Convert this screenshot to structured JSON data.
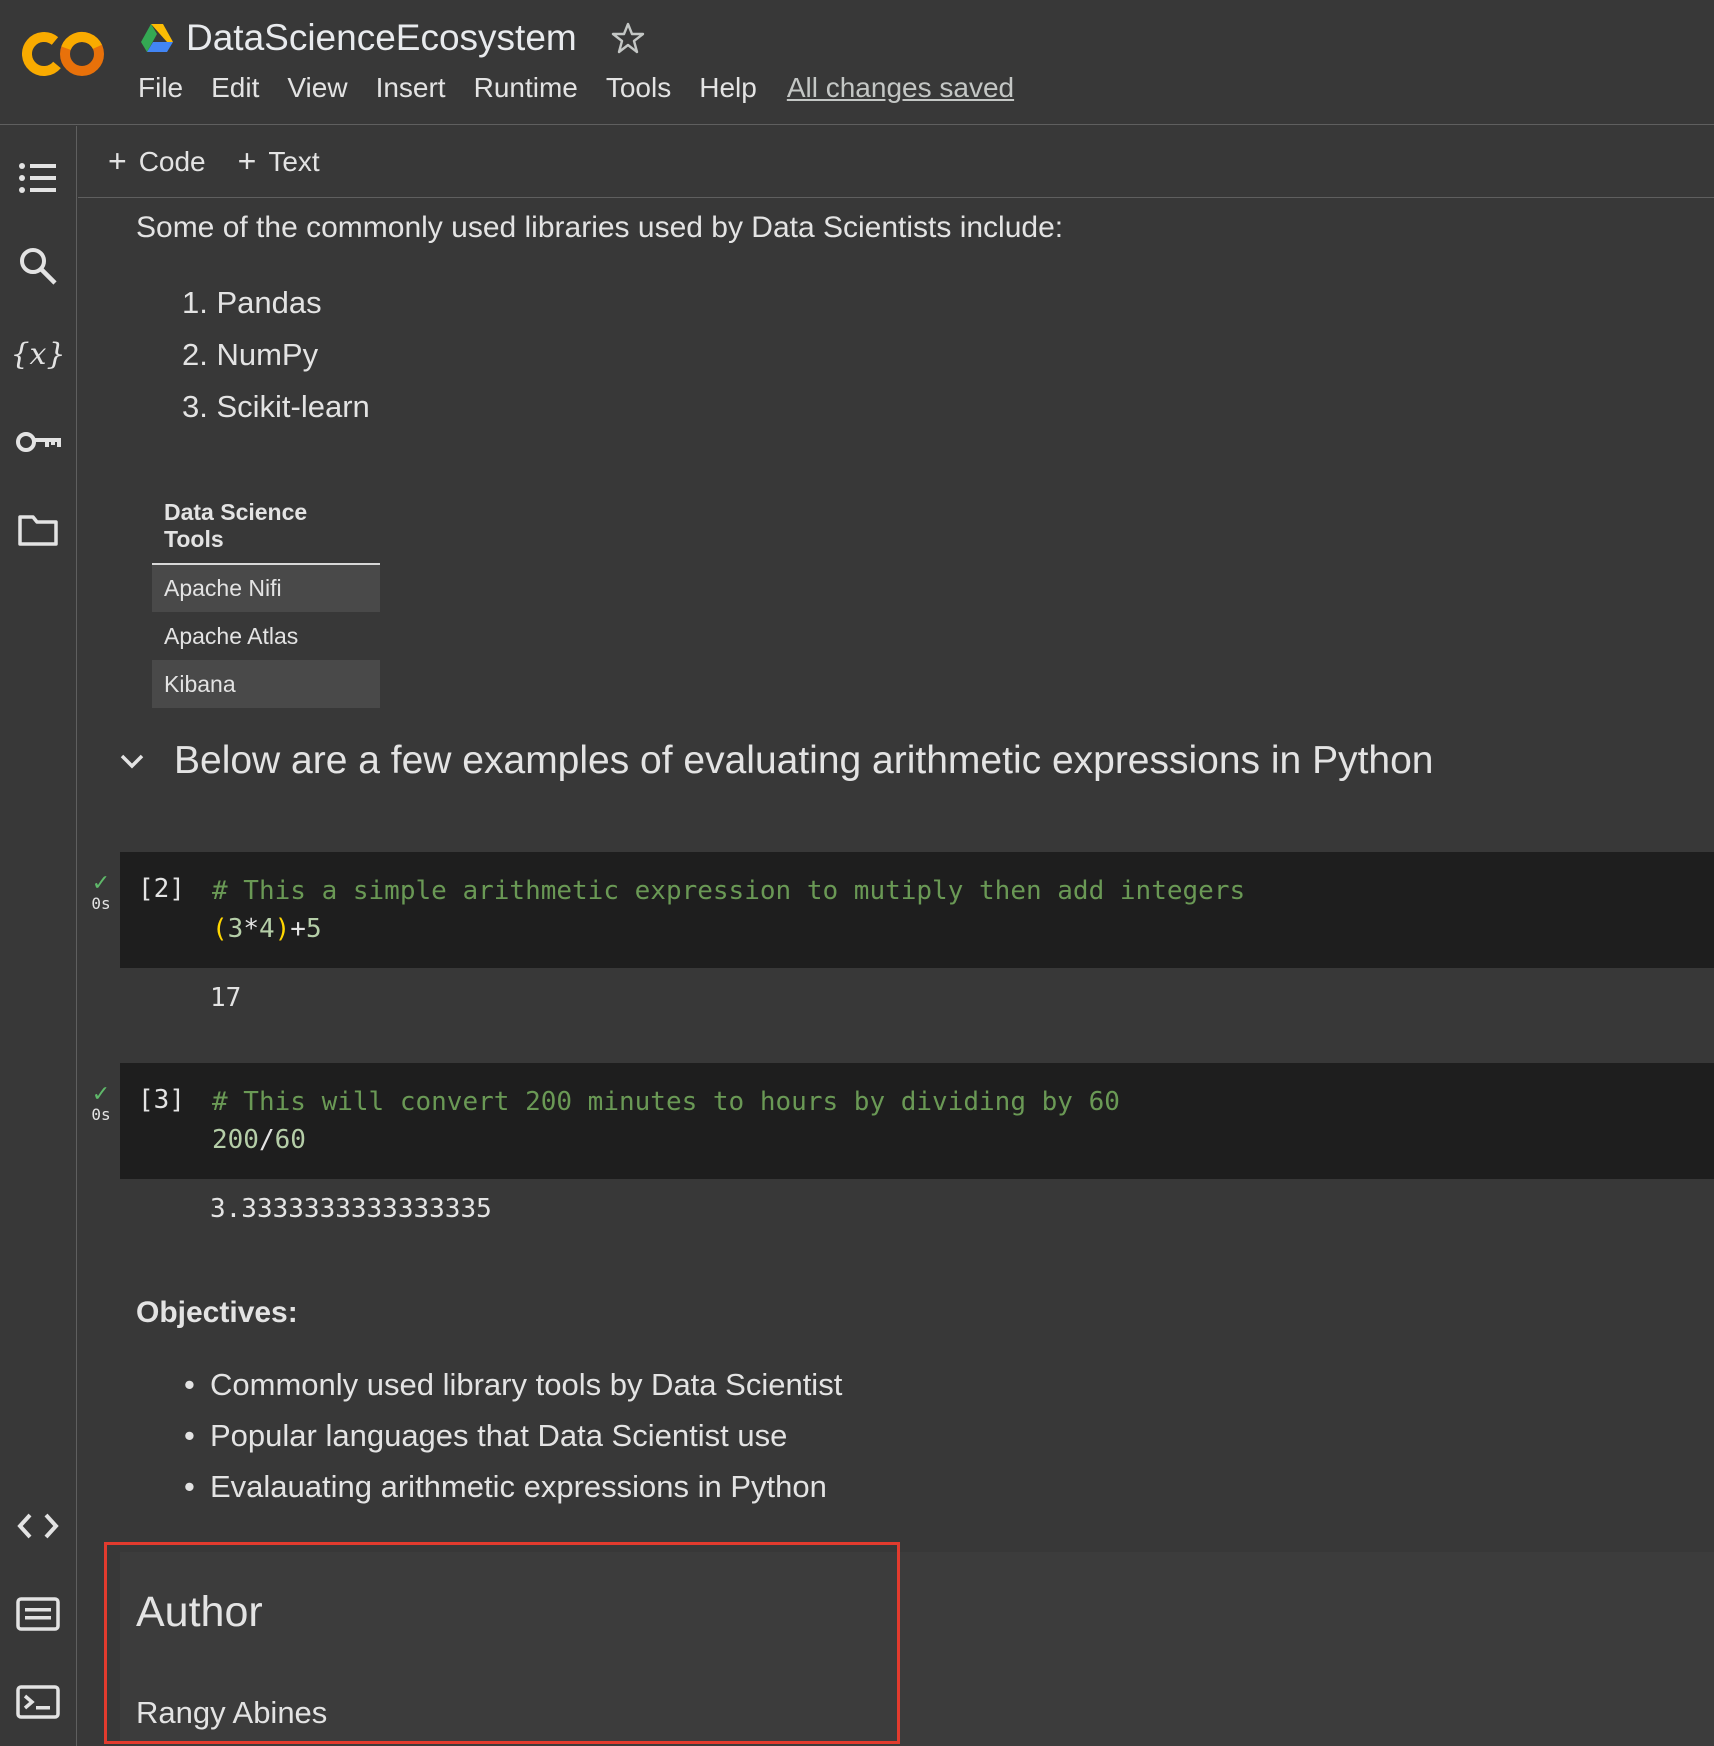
{
  "header": {
    "title": "DataScienceEcosystem",
    "menu": [
      "File",
      "Edit",
      "View",
      "Insert",
      "Runtime",
      "Tools",
      "Help"
    ],
    "save_status": "All changes saved"
  },
  "toolbar": {
    "code_label": "Code",
    "text_label": "Text"
  },
  "rail": {
    "icons": [
      "table-of-contents-icon",
      "search-icon",
      "variables-icon",
      "secrets-key-icon",
      "files-folder-icon",
      "code-snippets-icon",
      "command-palette-icon",
      "terminal-icon"
    ]
  },
  "intro": {
    "text": "Some of the commonly used libraries used by Data Scientists include:",
    "libraries": [
      "1. Pandas",
      "2. NumPy",
      "3. Scikit-learn"
    ]
  },
  "tools_table": {
    "header": "Data Science Tools",
    "rows": [
      "Apache Nifi",
      "Apache Atlas",
      "Kibana"
    ]
  },
  "section": {
    "heading": "Below are a few examples of evaluating arithmetic expressions in Python"
  },
  "cells": [
    {
      "exec_count": "[2]",
      "status_time": "0s",
      "comment": "# This a simple arithmetic expression to mutiply then add integers",
      "code_parts": [
        "(",
        "3",
        "*",
        "4",
        ")",
        "+",
        "5"
      ],
      "output": "17"
    },
    {
      "exec_count": "[3]",
      "status_time": "0s",
      "comment": "# This will convert 200 minutes to hours by dividing by 60",
      "code_parts": [
        "200",
        "/",
        "60"
      ],
      "output": "3.3333333333333335"
    }
  ],
  "objectives": {
    "title": "Objectives:",
    "items": [
      "Commonly used library tools by Data Scientist",
      "Popular languages that Data Scientist use",
      "Evalauating arithmetic expressions in Python"
    ]
  },
  "author": {
    "title": "Author",
    "name": "Rangy Abines"
  },
  "colors": {
    "highlight_box": "#e23b2e",
    "comment": "#6a9955",
    "number": "#b5cea8",
    "paren": "#ffd700",
    "check": "#5fb96a"
  }
}
